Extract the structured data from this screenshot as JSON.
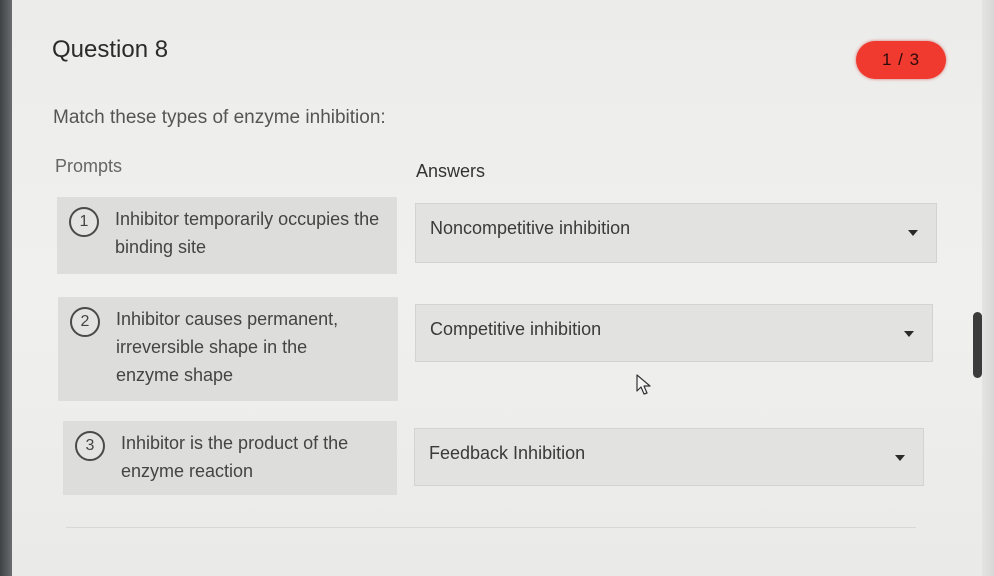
{
  "question": {
    "title": "Question 8",
    "progress_badge": "1 / 3",
    "instruction": "Match these types of enzyme inhibition:"
  },
  "headers": {
    "prompts": "Prompts",
    "answers": "Answers"
  },
  "pairs": [
    {
      "number": "1",
      "prompt": "Inhibitor temporarily occupies the binding site",
      "answer": "Noncompetitive inhibition"
    },
    {
      "number": "2",
      "prompt": "Inhibitor causes permanent, irreversible shape in the enzyme shape",
      "answer": "Competitive inhibition"
    },
    {
      "number": "3",
      "prompt": "Inhibitor is the product of the enzyme reaction",
      "answer": "Feedback Inhibition"
    }
  ],
  "colors": {
    "badge": "#f0392f",
    "panel": "#ececea",
    "prompt_bg": "#dddddb"
  },
  "icons": [
    "chevron-down-icon",
    "mouse-cursor-icon"
  ]
}
